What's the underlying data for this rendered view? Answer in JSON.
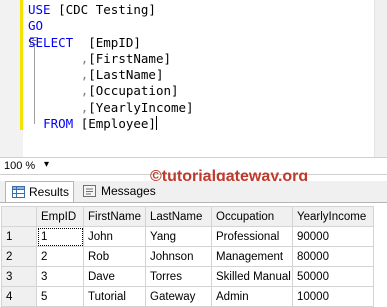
{
  "editor": {
    "lines": [
      {
        "kw": "USE",
        "rest": " [CDC Testing]"
      },
      {
        "kw": "GO",
        "rest": ""
      },
      {
        "kw": "SELECT",
        "rest": "  [EmpID]"
      },
      {
        "comma": ",",
        "rest": "[FirstName]"
      },
      {
        "comma": ",",
        "rest": "[LastName]"
      },
      {
        "comma": ",",
        "rest": "[Occupation]"
      },
      {
        "comma": ",",
        "rest": "[YearlyIncome]"
      },
      {
        "kw": "FROM",
        "rest": " [Employee]"
      }
    ],
    "outline_symbol": "−"
  },
  "statusbar": {
    "zoom": "100 %",
    "zoom_arrow": "▾"
  },
  "watermark": "©tutorialgateway.org",
  "tabs": {
    "results": "Results",
    "messages": "Messages"
  },
  "grid": {
    "columns": [
      "EmpID",
      "FirstName",
      "LastName",
      "Occupation",
      "YearlyIncome"
    ],
    "rows": [
      {
        "n": "1",
        "cells": [
          "1",
          "John",
          "Yang",
          "Professional",
          "90000"
        ]
      },
      {
        "n": "2",
        "cells": [
          "2",
          "Rob",
          "Johnson",
          "Management",
          "80000"
        ]
      },
      {
        "n": "3",
        "cells": [
          "3",
          "Dave",
          "Torres",
          "Skilled Manual",
          "50000"
        ]
      },
      {
        "n": "4",
        "cells": [
          "5",
          "Tutorial",
          "Gateway",
          "Admin",
          "10000"
        ]
      }
    ]
  },
  "colors": {
    "keyword": "#0000ff",
    "watermark": "#c0392b",
    "margin_marker": "#f4e300"
  }
}
